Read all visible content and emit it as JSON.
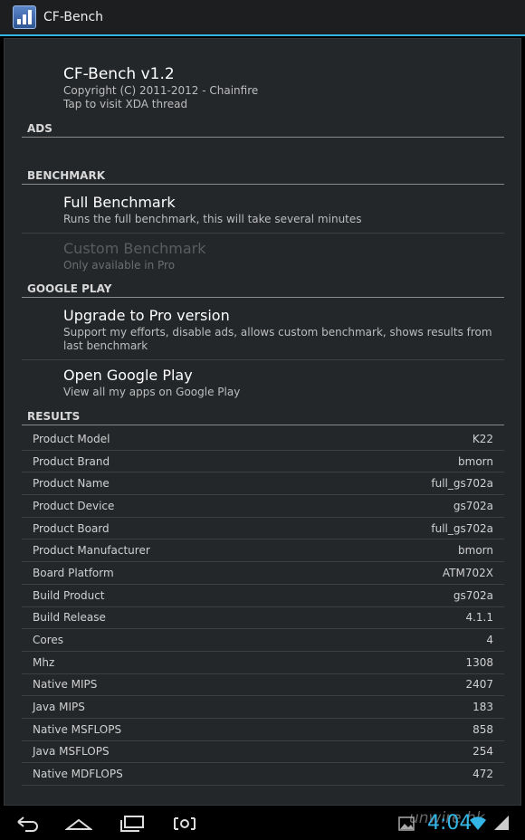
{
  "app": {
    "title": "CF-Bench"
  },
  "about": {
    "title": "CF-Bench v1.2",
    "copyright": "Copyright (C) 2011-2012 - Chainfire",
    "tap": "Tap to visit XDA thread"
  },
  "categories": {
    "ads": "ADS",
    "benchmark": "BENCHMARK",
    "google_play": "GOOGLE PLAY",
    "results": "RESULTS"
  },
  "benchmark": {
    "full_title": "Full Benchmark",
    "full_summary": "Runs the full benchmark, this will take several minutes",
    "custom_title": "Custom Benchmark",
    "custom_summary": "Only available in Pro"
  },
  "google_play": {
    "upgrade_title": "Upgrade to Pro version",
    "upgrade_summary": "Support my efforts, disable ads, allows custom benchmark, shows results from last benchmark",
    "open_title": "Open Google Play",
    "open_summary": "View all my apps on Google Play"
  },
  "results": [
    {
      "label": "Product Model",
      "value": "K22"
    },
    {
      "label": "Product Brand",
      "value": "bmorn"
    },
    {
      "label": "Product Name",
      "value": "full_gs702a"
    },
    {
      "label": "Product Device",
      "value": "gs702a"
    },
    {
      "label": "Product Board",
      "value": "full_gs702a"
    },
    {
      "label": "Product Manufacturer",
      "value": "bmorn"
    },
    {
      "label": "Board Platform",
      "value": "ATM702X"
    },
    {
      "label": "Build Product",
      "value": "gs702a"
    },
    {
      "label": "Build Release",
      "value": "4.1.1"
    },
    {
      "label": "Cores",
      "value": "4"
    },
    {
      "label": "Mhz",
      "value": "1308"
    },
    {
      "label": "Native MIPS",
      "value": "2407"
    },
    {
      "label": "Java MIPS",
      "value": "183"
    },
    {
      "label": "Native MSFLOPS",
      "value": "858"
    },
    {
      "label": "Java MSFLOPS",
      "value": "254"
    },
    {
      "label": "Native MDFLOPS",
      "value": "472"
    }
  ],
  "status_bar": {
    "time": "4:04",
    "watermark": "unwire.hk"
  },
  "icons": [
    "back-icon",
    "home-icon",
    "recent-apps-icon",
    "screenshot-icon",
    "gallery-notification-icon",
    "wifi-icon",
    "signal-icon"
  ],
  "colors": {
    "accent": "#33b5e5",
    "background": "#24272a"
  }
}
